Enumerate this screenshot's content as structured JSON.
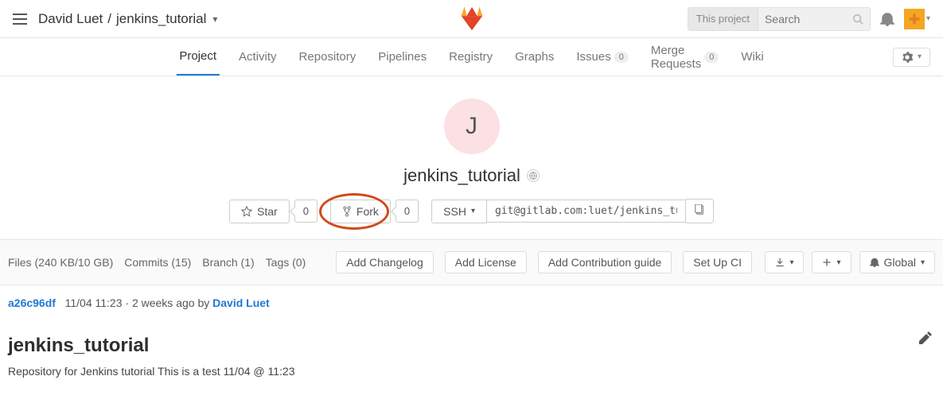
{
  "header": {
    "breadcrumb_owner": "David Luet",
    "breadcrumb_sep": "/",
    "breadcrumb_project": "jenkins_tutorial",
    "search_scope": "This project",
    "search_placeholder": "Search"
  },
  "navtabs": [
    {
      "label": "Project",
      "active": true
    },
    {
      "label": "Activity"
    },
    {
      "label": "Repository"
    },
    {
      "label": "Pipelines"
    },
    {
      "label": "Registry"
    },
    {
      "label": "Graphs"
    },
    {
      "label": "Issues",
      "count": "0"
    },
    {
      "label": "Merge Requests",
      "count": "0"
    },
    {
      "label": "Wiki"
    }
  ],
  "project": {
    "avatar_letter": "J",
    "name": "jenkins_tutorial"
  },
  "actions": {
    "star_label": "Star",
    "star_count": "0",
    "fork_label": "Fork",
    "fork_count": "0",
    "proto_label": "SSH",
    "clone_url": "git@gitlab.com:luet/jenkins_tu"
  },
  "stats": {
    "files": "Files (240 KB/10 GB)",
    "commits": "Commits (15)",
    "branch": "Branch (1)",
    "tags": "Tags (0)",
    "changelog": "Add Changelog",
    "license": "Add License",
    "contrib": "Add Contribution guide",
    "ci": "Set Up CI",
    "global": "Global"
  },
  "commit": {
    "sha": "a26c96df",
    "time": "11/04 11:23",
    "rel": "2 weeks ago",
    "by": "by",
    "author": "David Luet"
  },
  "readme": {
    "title": "jenkins_tutorial",
    "body": "Repository for Jenkins tutorial This is a test 11/04 @ 11:23"
  }
}
